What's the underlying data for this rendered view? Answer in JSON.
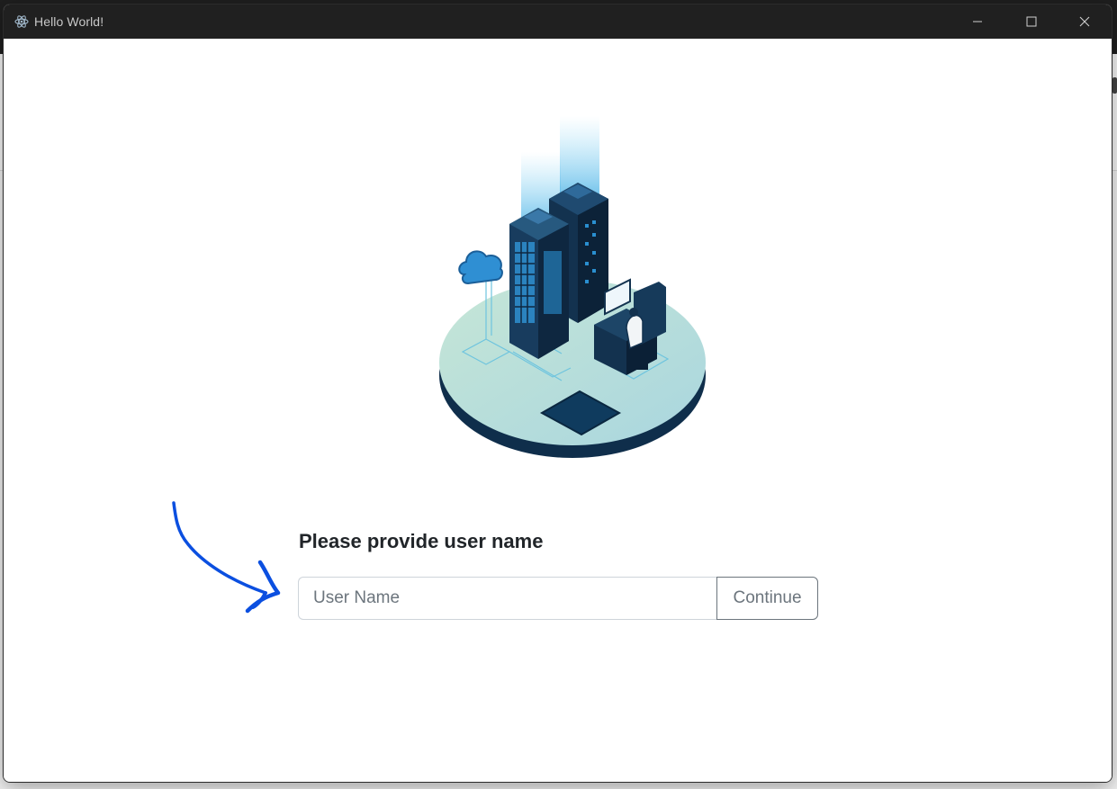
{
  "window": {
    "title": "Hello World!",
    "icon": "electron-atom-icon",
    "controls": [
      "minimize-icon",
      "maximize-icon",
      "close-icon"
    ]
  },
  "form": {
    "title": "Please provide user name",
    "input_placeholder": "User Name",
    "input_value": "",
    "continue_label": "Continue"
  },
  "colors": {
    "titlebar": "#202020",
    "accent_arrow": "#0b4fe0",
    "text_dark": "#212529",
    "muted": "#6c757d"
  }
}
